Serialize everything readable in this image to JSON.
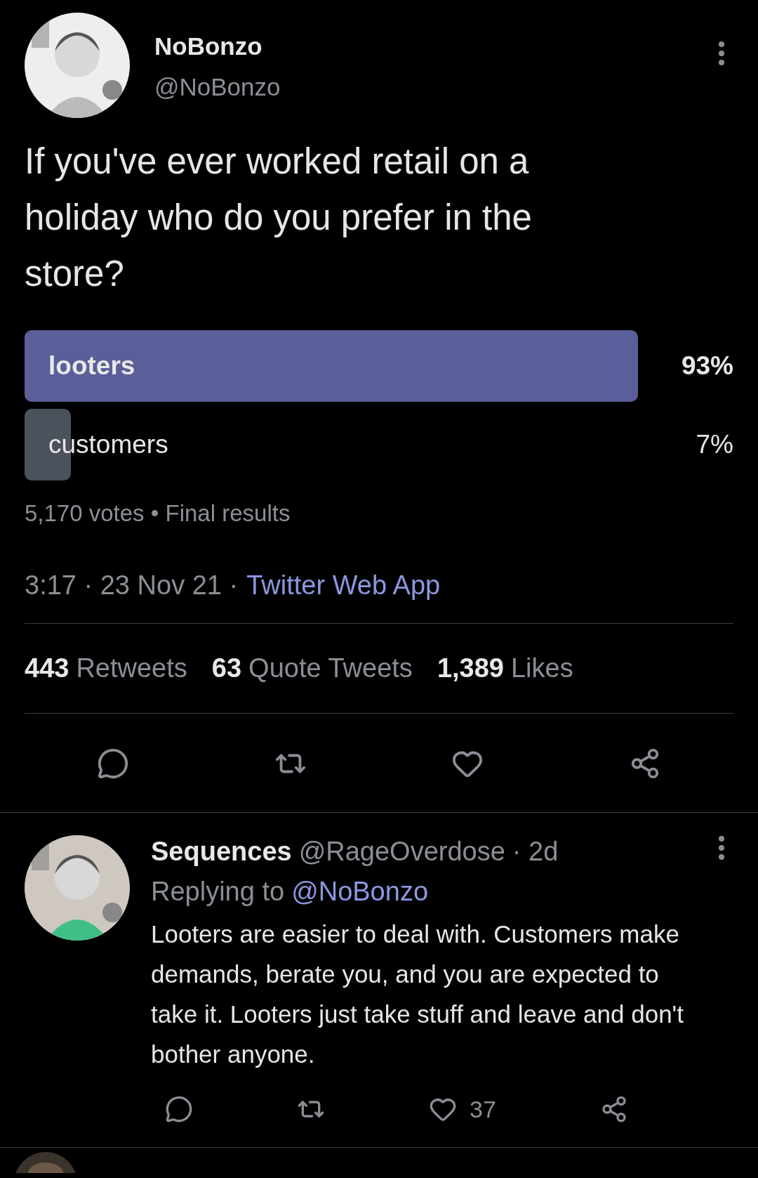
{
  "tweet": {
    "name": "NoBonzo",
    "handle": "@NoBonzo",
    "text": "If you've ever worked retail on a holiday who do you prefer in the store?",
    "poll": {
      "options": [
        {
          "label": "looters",
          "percent": "93%",
          "selected": true
        },
        {
          "label": "customers",
          "percent": "7%",
          "selected": false
        }
      ],
      "summary": "5,170 votes • Final results"
    },
    "meta": "3:17 · 23 Nov 21 ·",
    "source": "Twitter Web App",
    "stats": [
      {
        "count": "443",
        "label": "Retweets"
      },
      {
        "count": "63",
        "label": "Quote Tweets"
      },
      {
        "count": "1,389",
        "label": "Likes"
      }
    ]
  },
  "reply": {
    "name": "Sequences",
    "handle": "@RageOverdose",
    "age": "· 2d",
    "replying_label": "Replying to",
    "replying_to": "@NoBonzo",
    "text": "Looters are easier to deal with. Customers make demands, berate you, and you are expected to take it. Looters just take stuff and leave and don't bother anyone.",
    "like_count": "37"
  }
}
